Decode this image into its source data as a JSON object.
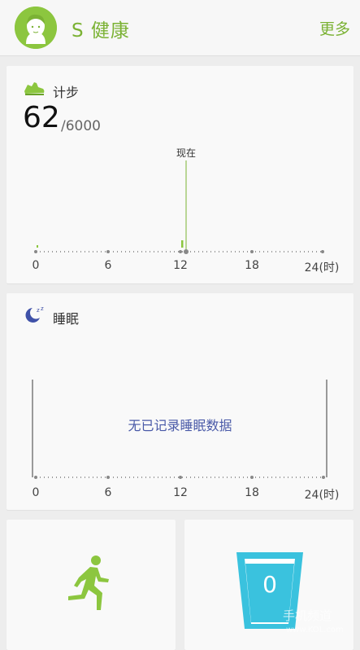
{
  "header": {
    "title": "S 健康",
    "more_label": "更多",
    "brand_color": "#7bb234"
  },
  "steps_card": {
    "title": "计步",
    "icon": "shoe-icon",
    "value": "62",
    "goal": "/6000",
    "now_label": "现在",
    "axis_labels": [
      "0",
      "6",
      "12",
      "18",
      "24(时)"
    ]
  },
  "sleep_card": {
    "title": "睡眠",
    "icon": "moon-zzz-icon",
    "no_data": "无已记录睡眠数据",
    "axis_labels": [
      "0",
      "6",
      "12",
      "18",
      "24(时)"
    ]
  },
  "exercise_card": {
    "icon": "runner-icon"
  },
  "water_card": {
    "icon": "water-glass-icon",
    "count": "0"
  },
  "watermark": {
    "line1": "手机频道",
    "line2": "www.KOL.com"
  }
}
